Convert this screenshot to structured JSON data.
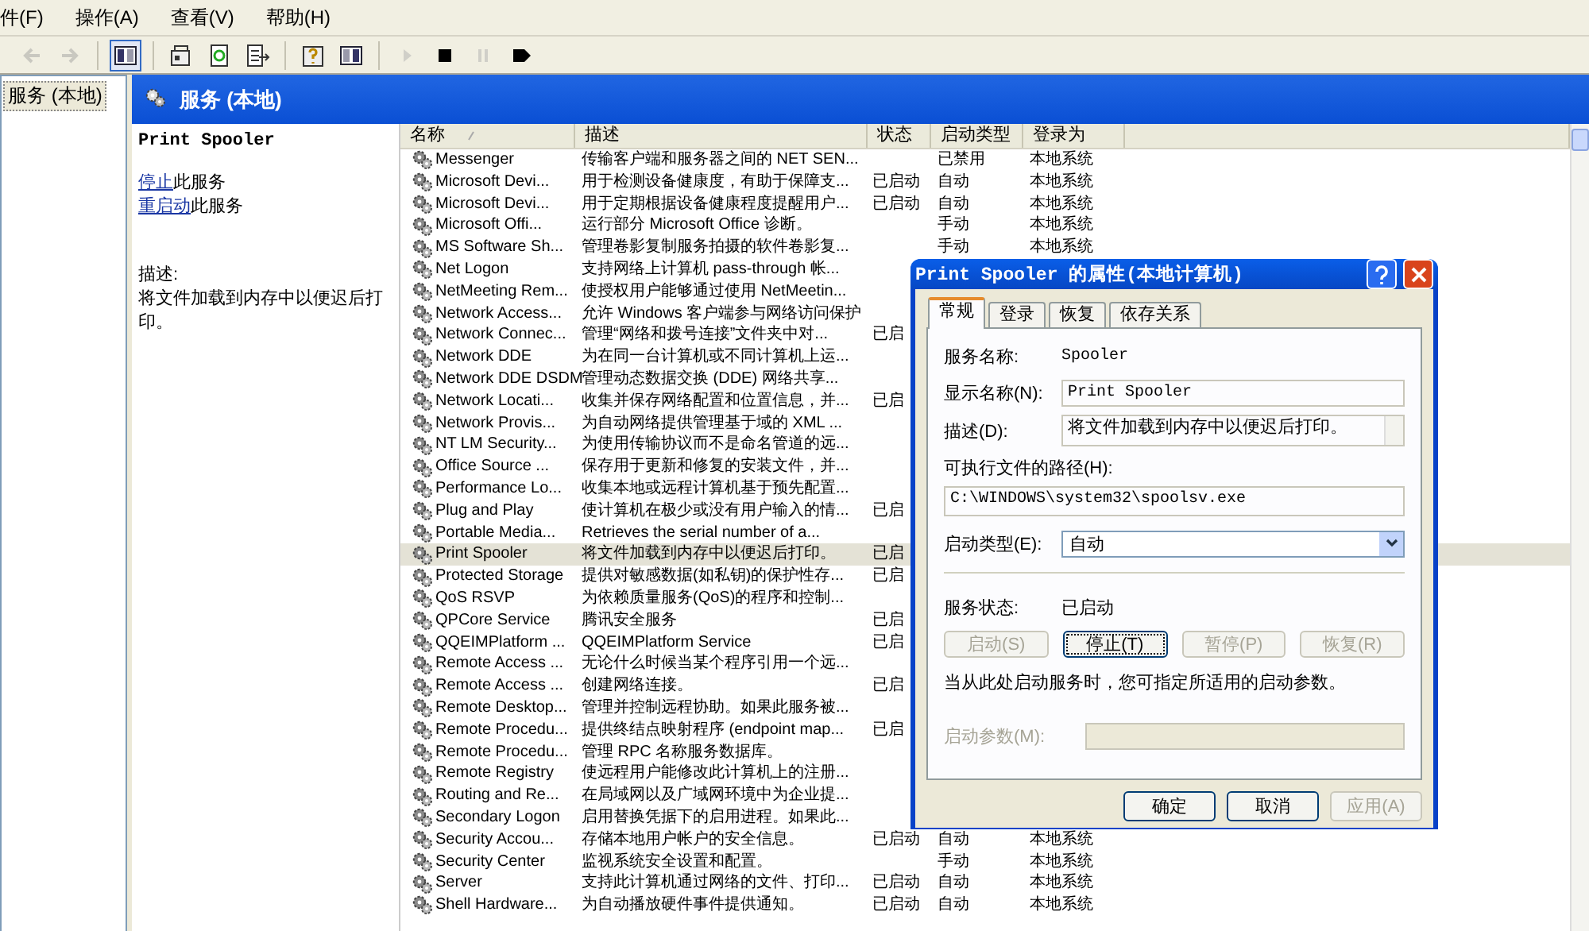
{
  "menu": [
    {
      "label": "件(F)"
    },
    {
      "label": "操作(A)"
    },
    {
      "label": "查看(V)"
    },
    {
      "label": "帮助(H)"
    }
  ],
  "toolbar": [
    {
      "kind": "back",
      "disabled": true
    },
    {
      "kind": "forward",
      "disabled": true
    },
    {
      "kind": "tree",
      "pressed": true
    },
    {
      "kind": "properties",
      "disabled": false
    },
    {
      "kind": "refresh",
      "disabled": false
    },
    {
      "kind": "export",
      "disabled": false
    },
    {
      "kind": "help",
      "disabled": false
    },
    {
      "kind": "pane",
      "disabled": false
    },
    {
      "kind": "play",
      "disabled": true
    },
    {
      "kind": "stop",
      "disabled": false
    },
    {
      "kind": "pause",
      "disabled": true
    },
    {
      "kind": "restart",
      "disabled": false
    }
  ],
  "tree": [
    {
      "label": "服务 (本地)",
      "selected": true
    }
  ],
  "header": {
    "title": "服务 (本地)"
  },
  "detail": {
    "name": "Print Spooler",
    "actions": [
      {
        "link": "停止",
        "rest": "此服务"
      },
      {
        "link": "重启动",
        "rest": "此服务"
      }
    ],
    "description_label": "描述:",
    "description": "将文件加载到内存中以便迟后打印。"
  },
  "table": {
    "columns": [
      "名称",
      "描述",
      "状态",
      "启动类型",
      "登录为"
    ],
    "rows": [
      {
        "name": "Messenger",
        "description": "传输客户端和服务器之间的 NET SEN...",
        "startup_type": "已禁用",
        "log_on_as": "本地系统",
        "selected": false
      },
      {
        "name": "Microsoft Devi...",
        "description": "用于检测设备健康度，有助于保障支...",
        "status": "已启动",
        "startup_type": "自动",
        "log_on_as": "本地系统",
        "selected": false
      },
      {
        "name": "Microsoft Devi...",
        "description": "用于定期根据设备健康程度提醒用户...",
        "status": "已启动",
        "startup_type": "自动",
        "log_on_as": "本地系统",
        "selected": false
      },
      {
        "name": "Microsoft Offi...",
        "description": "运行部分 Microsoft Office 诊断。",
        "startup_type": "手动",
        "log_on_as": "本地系统",
        "selected": false
      },
      {
        "name": "MS Software Sh...",
        "description": "管理卷影复制服务拍摄的软件卷影复...",
        "startup_type": "手动",
        "log_on_as": "本地系统",
        "selected": false
      },
      {
        "name": "Net Logon",
        "description": "支持网络上计算机 pass-through 帐...",
        "selected": false
      },
      {
        "name": "NetMeeting Rem...",
        "description": "使授权用户能够通过使用 NetMeetin...",
        "selected": false
      },
      {
        "name": "Network Access...",
        "description": "允许 Windows 客户端参与网络访问保护",
        "selected": false
      },
      {
        "name": "Network Connec...",
        "description": "管理“网络和拨号连接”文件夹中对...",
        "status": "已启",
        "selected": false
      },
      {
        "name": "Network DDE",
        "description": "为在同一台计算机或不同计算机上运...",
        "selected": false
      },
      {
        "name": "Network DDE DSDM",
        "description": "管理动态数据交换 (DDE) 网络共享...",
        "selected": false
      },
      {
        "name": "Network Locati...",
        "description": "收集并保存网络配置和位置信息，并...",
        "status": "已启",
        "selected": false
      },
      {
        "name": "Network Provis...",
        "description": "为自动网络提供管理基于域的 XML ...",
        "selected": false
      },
      {
        "name": "NT LM Security...",
        "description": "为使用传输协议而不是命名管道的远...",
        "selected": false
      },
      {
        "name": "Office Source ...",
        "description": "保存用于更新和修复的安装文件，并...",
        "selected": false
      },
      {
        "name": "Performance Lo...",
        "description": "收集本地或远程计算机基于预先配置...",
        "selected": false
      },
      {
        "name": "Plug and Play",
        "description": "使计算机在极少或没有用户输入的情...",
        "status": "已启",
        "selected": false
      },
      {
        "name": "Portable Media...",
        "description": "Retrieves the serial number of a...",
        "selected": false
      },
      {
        "name": "Print Spooler",
        "description": "将文件加载到内存中以便迟后打印。",
        "status": "已启",
        "selected": true
      },
      {
        "name": "Protected Storage",
        "description": "提供对敏感数据(如私钥)的保护性存...",
        "status": "已启",
        "selected": false
      },
      {
        "name": "QoS RSVP",
        "description": "为依赖质量服务(QoS)的程序和控制...",
        "selected": false
      },
      {
        "name": "QPCore Service",
        "description": "腾讯安全服务",
        "status": "已启",
        "selected": false
      },
      {
        "name": "QQEIMPlatform ...",
        "description": "QQEIMPlatform Service",
        "status": "已启",
        "selected": false
      },
      {
        "name": "Remote Access ...",
        "description": "无论什么时候当某个程序引用一个远...",
        "selected": false
      },
      {
        "name": "Remote Access ...",
        "description": "创建网络连接。",
        "status": "已启",
        "selected": false
      },
      {
        "name": "Remote Desktop...",
        "description": "管理并控制远程协助。如果此服务被...",
        "selected": false
      },
      {
        "name": "Remote Procedu...",
        "description": "提供终结点映射程序 (endpoint map...",
        "status": "已启",
        "selected": false
      },
      {
        "name": "Remote Procedu...",
        "description": "管理 RPC 名称服务数据库。",
        "selected": false
      },
      {
        "name": "Remote Registry",
        "description": "使远程用户能修改此计算机上的注册...",
        "selected": false
      },
      {
        "name": "Routing and Re...",
        "description": "在局域网以及广域网环境中为企业提...",
        "selected": false
      },
      {
        "name": "Secondary Logon",
        "description": "启用替换凭据下的启用进程。如果此...",
        "selected": false
      },
      {
        "name": "Security Accou...",
        "description": "存储本地用户帐户的安全信息。",
        "status": "已启动",
        "startup_type": "自动",
        "log_on_as": "本地系统",
        "selected": false
      },
      {
        "name": "Security Center",
        "description": "监视系统安全设置和配置。",
        "startup_type": "手动",
        "log_on_as": "本地系统",
        "selected": false
      },
      {
        "name": "Server",
        "description": "支持此计算机通过网络的文件、打印...",
        "status": "已启动",
        "startup_type": "自动",
        "log_on_as": "本地系统",
        "selected": false
      },
      {
        "name": "Shell Hardware...",
        "description": "为自动播放硬件事件提供通知。",
        "status": "已启动",
        "startup_type": "自动",
        "log_on_as": "本地系统",
        "selected": false
      }
    ]
  },
  "dialog": {
    "title": "Print Spooler 的属性(本地计算机)",
    "tabs": [
      {
        "label": "常规",
        "selected": true
      },
      {
        "label": "登录",
        "selected": false
      },
      {
        "label": "恢复",
        "selected": false
      },
      {
        "label": "依存关系",
        "selected": false
      }
    ],
    "service_name": {
      "label": "服务名称:",
      "value": "Spooler"
    },
    "display_name": {
      "label": "显示名称(N):",
      "value": "Print Spooler"
    },
    "description": {
      "label": "描述(D):",
      "value": "将文件加载到内存中以便迟后打印。"
    },
    "path": {
      "label": "可执行文件的路径(H):",
      "value": "C:\\WINDOWS\\system32\\spoolsv.exe"
    },
    "startup_type": {
      "label": "启动类型(E):",
      "value": "自动"
    },
    "service_status": {
      "label": "服务状态:",
      "value": "已启动"
    },
    "control_buttons": [
      {
        "label": "启动(S)",
        "disabled": true,
        "focused": false
      },
      {
        "label": "停止(T)",
        "disabled": false,
        "focused": true
      },
      {
        "label": "暂停(P)",
        "disabled": true,
        "focused": false
      },
      {
        "label": "恢复(R)",
        "disabled": true,
        "focused": false
      }
    ],
    "hint": "当从此处启动服务时，您可指定所适用的启动参数。",
    "parameters": {
      "label": "启动参数(M):",
      "disabled": true
    },
    "buttons": [
      {
        "label": "确定",
        "disabled": false
      },
      {
        "label": "取消",
        "disabled": false
      },
      {
        "label": "应用(A)",
        "disabled": true
      }
    ]
  }
}
